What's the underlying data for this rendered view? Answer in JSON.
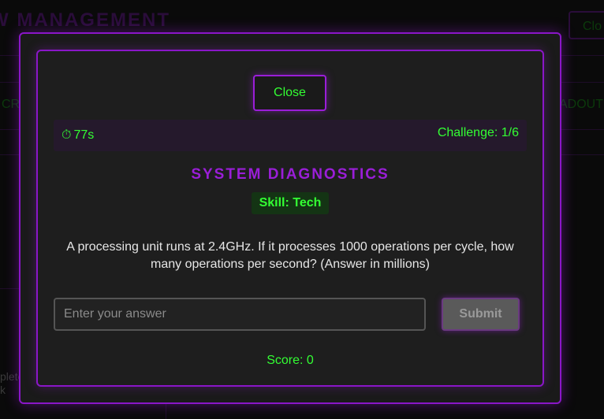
{
  "background": {
    "title": "W MANAGEMENT",
    "close_label": "Clo",
    "left_tab_fragment": "CR",
    "right_tab_fragment": "ADOUT",
    "corner_text_line1": "plete",
    "corner_text_line2": "k"
  },
  "modal": {
    "close_label": "Close",
    "timer_icon": "⏱",
    "timer_text": "77s",
    "challenge_text": "Challenge: 1/6",
    "heading": "SYSTEM DIAGNOSTICS",
    "skill_badge": "Skill: Tech",
    "question": "A processing unit runs at 2.4GHz. If it processes 1000 operations per cycle, how many operations per second? (Answer in millions)",
    "answer_placeholder": "Enter your answer",
    "answer_value": "",
    "submit_label": "Submit",
    "score_text": "Score: 0"
  },
  "colors": {
    "accent_purple": "#8a16c8",
    "terminal_green": "#33ff33",
    "panel_background": "#1e1e1e",
    "status_bar_background": "#25192c"
  },
  "icons": {
    "timer": "stopwatch-icon"
  }
}
